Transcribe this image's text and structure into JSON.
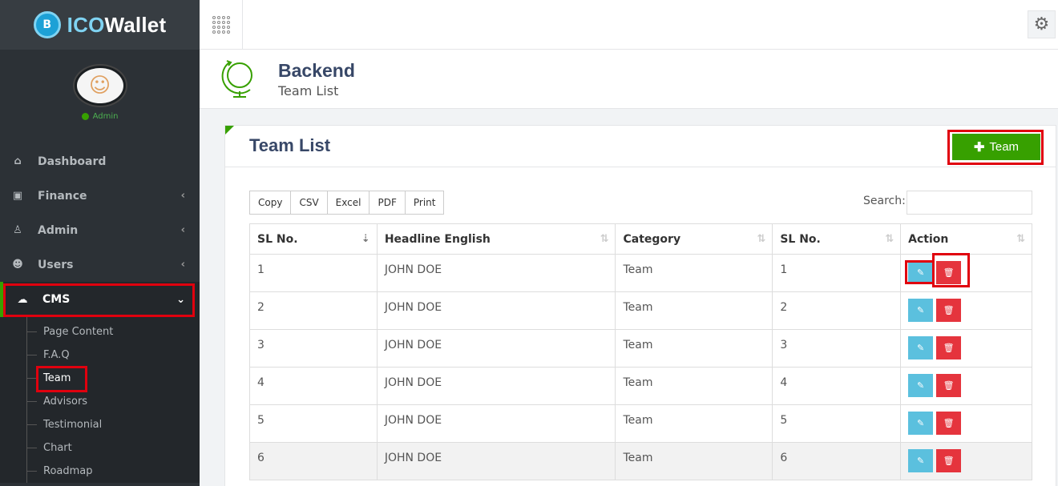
{
  "brand": {
    "prefix": "ICO",
    "suffix": "Wallet",
    "coin": "B"
  },
  "user": {
    "status": "Admin"
  },
  "menu": [
    {
      "label": "Dashboard",
      "icon": "home-icon",
      "glyph": "⌂",
      "has_children": false
    },
    {
      "label": "Finance",
      "icon": "money-icon",
      "glyph": "▣",
      "has_children": true
    },
    {
      "label": "Admin",
      "icon": "users-cog-icon",
      "glyph": "♙",
      "has_children": true
    },
    {
      "label": "Users",
      "icon": "users-icon",
      "glyph": "☻",
      "has_children": true
    },
    {
      "label": "CMS",
      "icon": "comments-icon",
      "glyph": "☁",
      "has_children": true,
      "active": true
    }
  ],
  "submenu": [
    "Page Content",
    "F.A.Q",
    "Team",
    "Advisors",
    "Testimonial",
    "Chart",
    "Roadmap"
  ],
  "header": {
    "title": "Backend",
    "subtitle": "Team List"
  },
  "panel": {
    "title": "Team List",
    "add_button": "Team",
    "export_buttons": [
      "Copy",
      "CSV",
      "Excel",
      "PDF",
      "Print"
    ],
    "search_label": "Search:",
    "search_value": ""
  },
  "table": {
    "columns": [
      "SL No.",
      "Headline English",
      "Category",
      "SL No.",
      "Action"
    ],
    "rows": [
      [
        "1",
        "JOHN DOE",
        "Team",
        "1"
      ],
      [
        "2",
        "JOHN DOE",
        "Team",
        "2"
      ],
      [
        "3",
        "JOHN DOE",
        "Team",
        "3"
      ],
      [
        "4",
        "JOHN DOE",
        "Team",
        "4"
      ],
      [
        "5",
        "JOHN DOE",
        "Team",
        "5"
      ],
      [
        "6",
        "JOHN DOE",
        "Team",
        "6"
      ]
    ]
  },
  "colors": {
    "accent": "#37a000",
    "sidebar": "#2c3136",
    "edit": "#5bc0de",
    "delete": "#e5343d",
    "highlight": "#e0000e"
  }
}
